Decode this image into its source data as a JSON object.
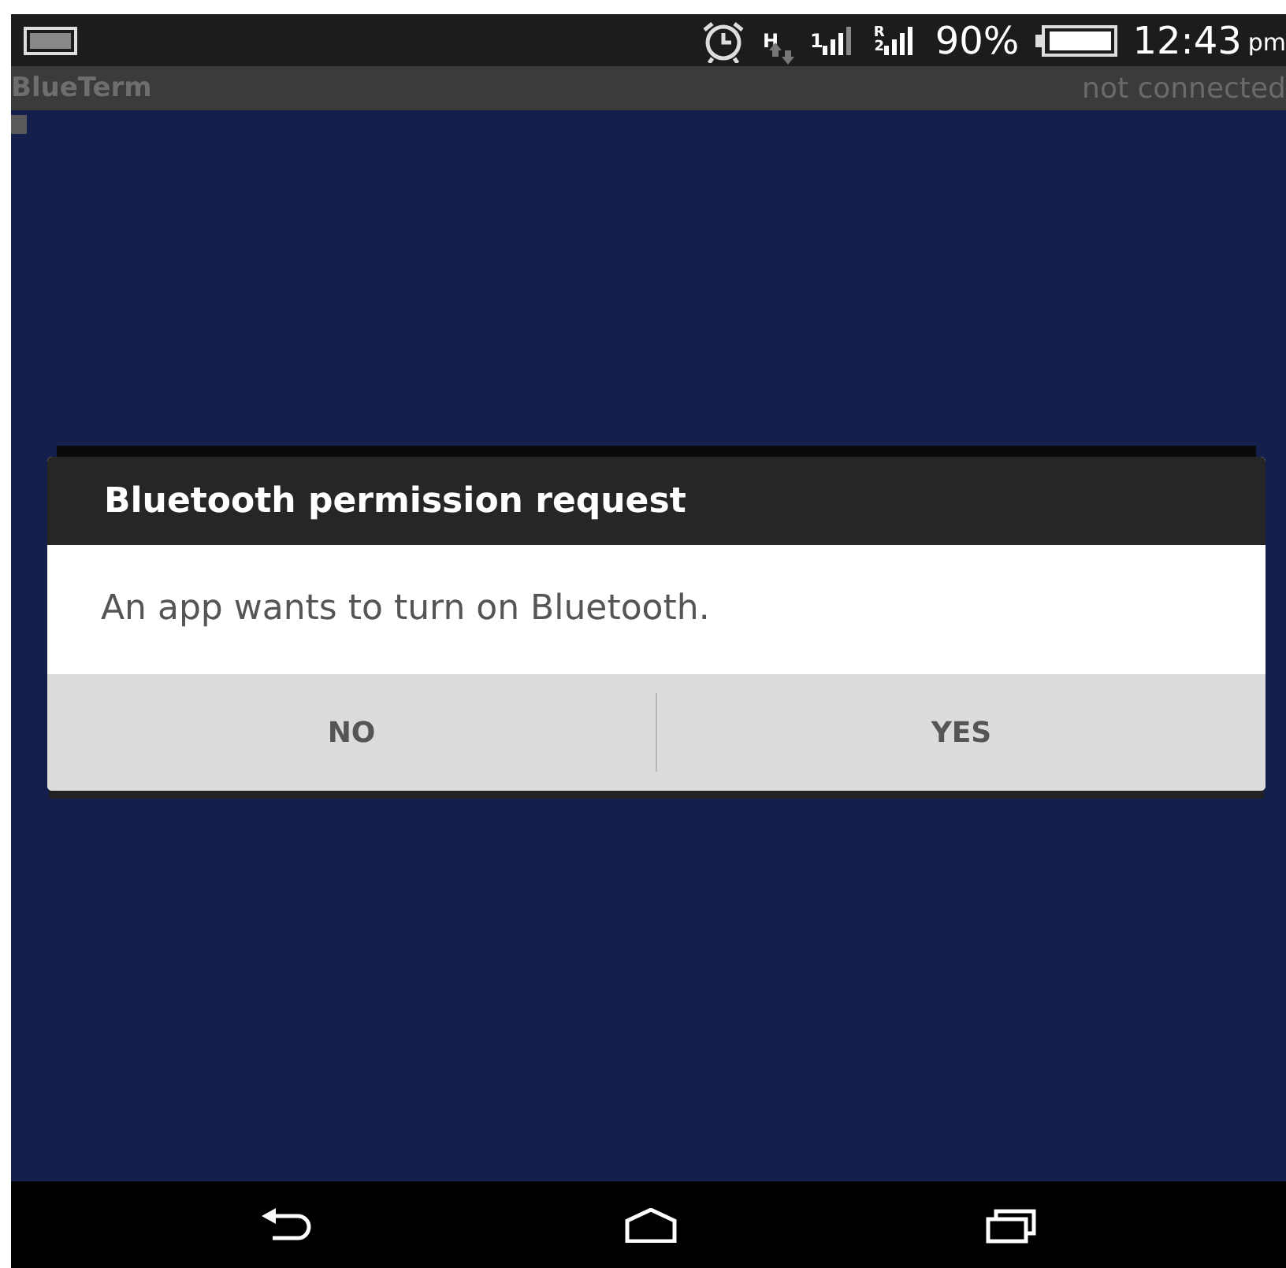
{
  "status_bar": {
    "network_type": "H",
    "sim1_label": "1",
    "sim2_label": "R\n2",
    "battery": "90%",
    "time": "12:43",
    "ampm": "pm"
  },
  "app_bar": {
    "title": "BlueTerm",
    "status": "not connected"
  },
  "dialog": {
    "title": "Bluetooth permission request",
    "message": "An app wants to turn on Bluetooth.",
    "buttons": [
      "NO",
      "YES"
    ]
  }
}
